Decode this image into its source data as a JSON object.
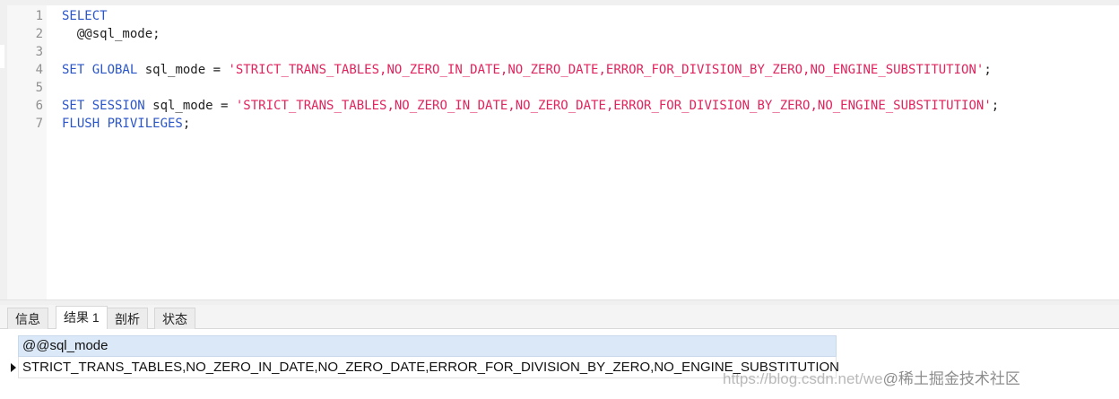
{
  "editor": {
    "line_numbers": [
      "1",
      "2",
      "3",
      "4",
      "5",
      "6",
      "7"
    ],
    "lines": [
      {
        "kw": "SELECT",
        "rest": "",
        "str": "",
        "end": ""
      },
      {
        "kw": "",
        "rest": "  @@sql_mode;",
        "str": "",
        "end": ""
      },
      {
        "kw": "",
        "rest": "",
        "str": "",
        "end": ""
      },
      {
        "kw": "SET GLOBAL",
        "rest": " sql_mode = ",
        "str": "'STRICT_TRANS_TABLES,NO_ZERO_IN_DATE,NO_ZERO_DATE,ERROR_FOR_DIVISION_BY_ZERO,NO_ENGINE_SUBSTITUTION'",
        "end": ";"
      },
      {
        "kw": "",
        "rest": "",
        "str": "",
        "end": ""
      },
      {
        "kw": "SET SESSION",
        "rest": " sql_mode = ",
        "str": "'STRICT_TRANS_TABLES,NO_ZERO_IN_DATE,NO_ZERO_DATE,ERROR_FOR_DIVISION_BY_ZERO,NO_ENGINE_SUBSTITUTION'",
        "end": ";"
      },
      {
        "kw": "FLUSH PRIVILEGES",
        "rest": "",
        "str": "",
        "end": ";"
      }
    ]
  },
  "tabs": [
    "信息",
    "结果 1",
    "剖析",
    "状态"
  ],
  "results": {
    "column_header": "@@sql_mode",
    "rows": [
      "STRICT_TRANS_TABLES,NO_ZERO_IN_DATE,NO_ZERO_DATE,ERROR_FOR_DIVISION_BY_ZERO,NO_ENGINE_SUBSTITUTION"
    ]
  },
  "watermark": {
    "url_text": "https://blog.csdn.net/we",
    "brand_text": "@稀土掘金技术社区"
  },
  "colors": {
    "keyword": "#2b56c8",
    "string": "#e0245e",
    "header_bg": "#dbe8f7"
  }
}
